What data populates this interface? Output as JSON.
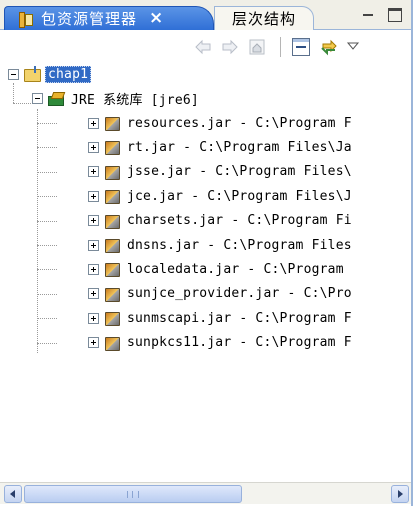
{
  "tabs": {
    "active_label": "包资源管理器",
    "close_glyph": "×",
    "inactive_label": "层次结构"
  },
  "icons": {
    "back": "back-arrow-icon",
    "forward": "forward-arrow-icon",
    "home": "home-icon",
    "collapse": "collapse-all-icon",
    "link": "link-with-editor-icon",
    "menu": "view-menu-icon"
  },
  "colors": {
    "active_tab": "#2f6fd6",
    "selection": "#316ac5"
  },
  "tree": {
    "project": "chap1",
    "library": "JRE 系统库 [jre6]",
    "jars": [
      "resources.jar - C:\\Program F",
      "rt.jar - C:\\Program Files\\Ja",
      "jsse.jar - C:\\Program Files\\",
      "jce.jar - C:\\Program Files\\J",
      "charsets.jar - C:\\Program Fi",
      "dnsns.jar - C:\\Program Files",
      "localedata.jar - C:\\Program",
      "sunjce_provider.jar - C:\\Pro",
      "sunmscapi.jar - C:\\Program F",
      "sunpkcs11.jar - C:\\Program F"
    ]
  }
}
